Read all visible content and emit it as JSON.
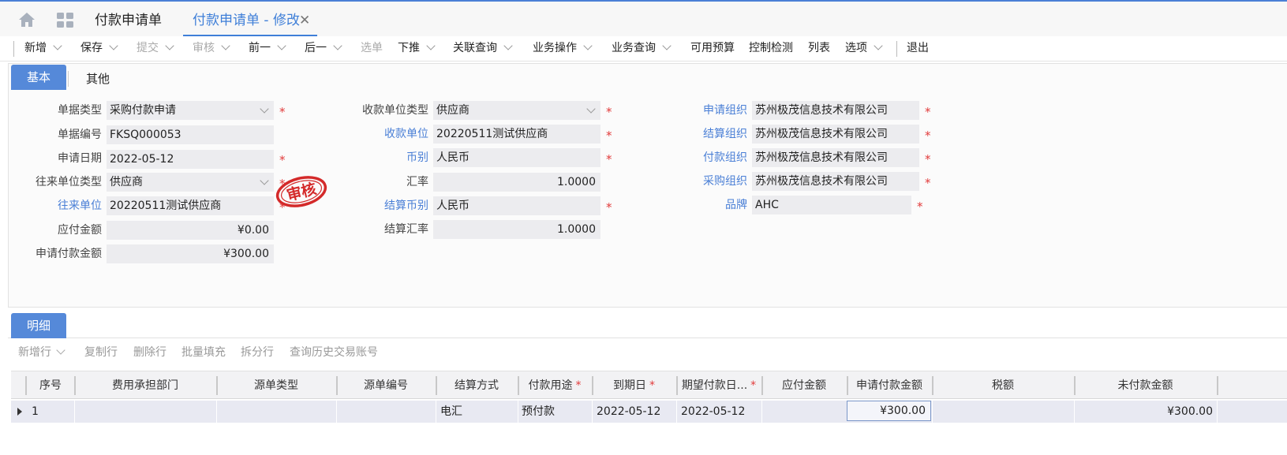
{
  "tabs": {
    "tab1": "付款申请单",
    "tab2": "付款申请单 - 修改",
    "close": "✕"
  },
  "toolbar": [
    {
      "label": "新增",
      "chev": true,
      "disabled": false
    },
    {
      "label": "保存",
      "chev": true,
      "disabled": false
    },
    {
      "label": "提交",
      "chev": true,
      "disabled": true
    },
    {
      "label": "审核",
      "chev": true,
      "disabled": true
    },
    {
      "label": "前一",
      "chev": true,
      "disabled": false
    },
    {
      "label": "后一",
      "chev": true,
      "disabled": false
    },
    {
      "label": "选单",
      "chev": false,
      "disabled": true
    },
    {
      "label": "下推",
      "chev": true,
      "disabled": false
    },
    {
      "label": "关联查询",
      "chev": true,
      "disabled": false
    },
    {
      "label": "业务操作",
      "chev": true,
      "disabled": false
    },
    {
      "label": "业务查询",
      "chev": true,
      "disabled": false
    },
    {
      "label": "可用预算",
      "chev": false,
      "disabled": false
    },
    {
      "label": "控制检测",
      "chev": false,
      "disabled": false
    },
    {
      "label": "列表",
      "chev": false,
      "disabled": false
    },
    {
      "label": "选项",
      "chev": true,
      "disabled": false
    },
    {
      "label": "退出",
      "chev": false,
      "disabled": false
    }
  ],
  "subtabs": {
    "basic": "基本",
    "other": "其他"
  },
  "form": {
    "bill_type_label": "单据类型",
    "bill_type": "采购付款申请",
    "bill_no_label": "单据编号",
    "bill_no": "FKSQ000053",
    "apply_date_label": "申请日期",
    "apply_date": "2022-05-12",
    "contact_type_label": "往来单位类型",
    "contact_type": "供应商",
    "contact_unit_label": "往来单位",
    "contact_unit": "20220511测试供应商",
    "payable_label": "应付金额",
    "payable": "¥0.00",
    "apply_amount_label": "申请付款金额",
    "apply_amount": "¥300.00",
    "payee_type_label": "收款单位类型",
    "payee_type": "供应商",
    "payee_label": "收款单位",
    "payee": "20220511测试供应商",
    "currency_label": "币别",
    "currency": "人民币",
    "rate_label": "汇率",
    "rate": "1.0000",
    "settle_currency_label": "结算币别",
    "settle_currency": "人民币",
    "settle_rate_label": "结算汇率",
    "settle_rate": "1.0000",
    "apply_org_label": "申请组织",
    "apply_org": "苏州极茂信息技术有限公司",
    "settle_org_label": "结算组织",
    "settle_org": "苏州极茂信息技术有限公司",
    "pay_org_label": "付款组织",
    "pay_org": "苏州极茂信息技术有限公司",
    "purchase_org_label": "采购组织",
    "purchase_org": "苏州极茂信息技术有限公司",
    "brand_label": "品牌",
    "brand": "AHC",
    "required_mark": "*"
  },
  "stamp_text": "审核",
  "detail": {
    "tab": "明细",
    "tools": [
      "新增行",
      "复制行",
      "删除行",
      "批量填充",
      "拆分行",
      "查询历史交易账号"
    ],
    "columns": [
      "序号",
      "费用承担部门",
      "源单类型",
      "源单编号",
      "结算方式",
      "付款用途",
      "到期日",
      "期望付款日...",
      "应付金额",
      "申请付款金额",
      "税额",
      "未付款金额"
    ],
    "row": {
      "seq": "1",
      "settle_method": "电汇",
      "pay_purpose": "预付款",
      "due_date": "2022-05-12",
      "expect_date": "2022-05-12",
      "apply_amount": "¥300.00",
      "unpaid": "¥300.00"
    }
  },
  "colors": {
    "accent": "#4a7fd6",
    "required": "#e23b3b",
    "stamp": "#d42a2a"
  }
}
